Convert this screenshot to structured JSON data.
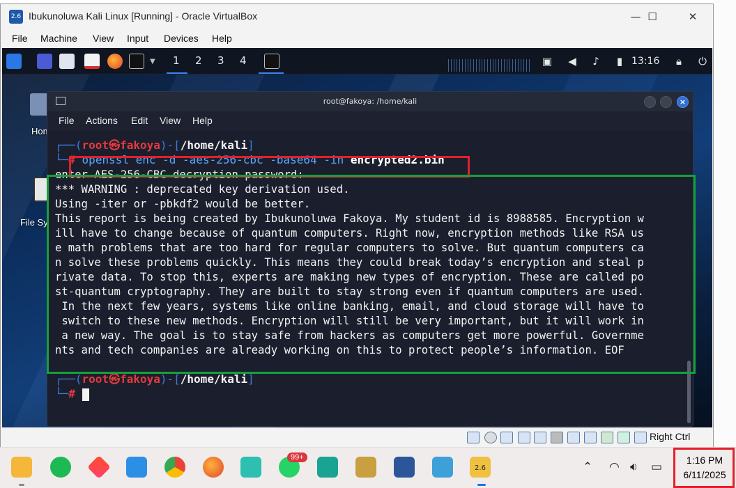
{
  "vbox": {
    "title": "Ibukunoluwa Kali Linux [Running] - Oracle VirtualBox",
    "app_icon_text": "2.6",
    "minimize": "—",
    "maximize": "☐",
    "close": "✕",
    "menu": [
      "File",
      "Machine",
      "View",
      "Input",
      "Devices",
      "Help"
    ],
    "host_key": "Right Ctrl"
  },
  "kali_panel": {
    "workspaces": [
      "1",
      "2",
      "3",
      "4"
    ],
    "clock": "13:16"
  },
  "desktop_icons": [
    "Home",
    "File Sy"
  ],
  "terminal": {
    "title": "root@fakoya: /home/kali",
    "menu": [
      "File",
      "Actions",
      "Edit",
      "View",
      "Help"
    ],
    "prompt1": {
      "top": "┌──(",
      "user": "root㉿fakoya",
      "mid": ")-[",
      "path": "/home/kali",
      "end": "]",
      "hash_prefix": "└─",
      "hash": "#",
      "cmd_plain": "openssl enc -d -aes-256-cbc -base64 -in ",
      "cmd_file": "encrypted2.bin"
    },
    "output_lines": [
      "enter AES-256-CBC decryption password:",
      "*** WARNING : deprecated key derivation used.",
      "Using -iter or -pbkdf2 would be better.",
      "This report is being created by Ibukunoluwa Fakoya. My student id is 8988585. Encryption w",
      "ill have to change because of quantum computers. Right now, encryption methods like RSA us",
      "e math problems that are too hard for regular computers to solve. But quantum computers ca",
      "n solve these problems quickly. This means they could break today’s encryption and steal p",
      "rivate data. To stop this, experts are making new types of encryption. These are called po",
      "st-quantum cryptography. They are built to stay strong even if quantum computers are used.",
      " In the next few years, systems like online banking, email, and cloud storage will have to",
      " switch to these new methods. Encryption will still be very important, but it will work in",
      " a new way. The goal is to stay safe from hackers as computers get more powerful. Governme",
      "nts and tech companies are already working on this to protect people’s information. EOF"
    ],
    "prompt2": {
      "top": "┌──(",
      "user": "root㉿fakoya",
      "mid": ")-[",
      "path": "/home/kali",
      "end": "]",
      "hash_prefix": "└─",
      "hash": "#"
    }
  },
  "taskbar": {
    "whatsapp_badge": "99+",
    "vbox_icon_text": "2.6",
    "clock_time": "1:16 PM",
    "clock_date": "6/11/2025"
  },
  "colors": {
    "red_highlight": "#e4202a",
    "green_highlight": "#16a03a",
    "prompt_user": "#e8383d",
    "prompt_frame": "#3b7be0",
    "command": "#58a6ff"
  }
}
